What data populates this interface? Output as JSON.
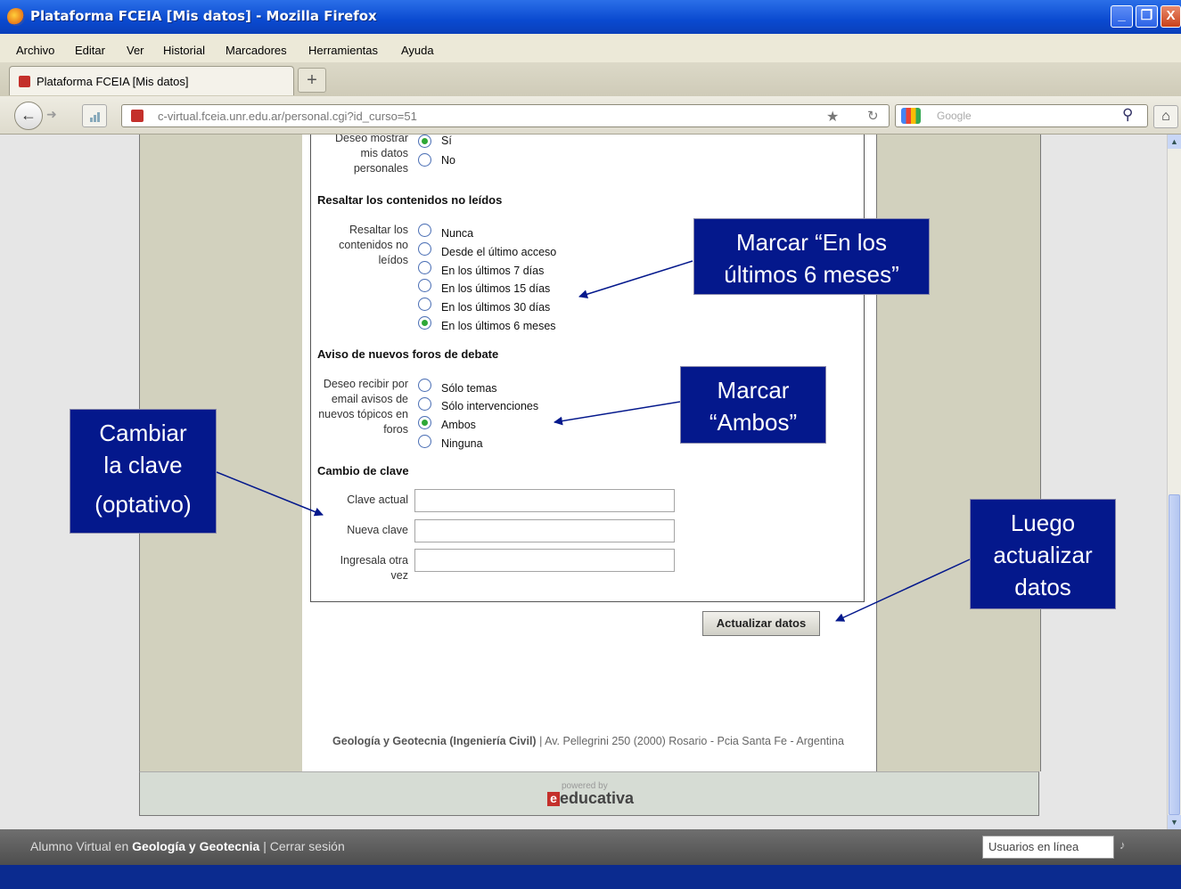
{
  "window": {
    "title": "Plataforma FCEIA [Mis datos] - Mozilla Firefox",
    "min_label": "_",
    "max_label": "❐",
    "close_label": "X"
  },
  "menu": [
    "Archivo",
    "Editar",
    "Ver",
    "Historial",
    "Marcadores",
    "Herramientas",
    "Ayuda"
  ],
  "tab": {
    "label": "Plataforma FCEIA [Mis datos]",
    "new_tab_label": "+"
  },
  "nav": {
    "url": "c-virtual.fceia.unr.edu.ar/personal.cgi?id_curso=51",
    "search_placeholder": "Google"
  },
  "form": {
    "personal": {
      "label": "Deseo mostrar mis datos personales",
      "options": [
        "Sí",
        "No"
      ],
      "selected": "Sí"
    },
    "resaltar": {
      "title": "Resaltar los contenidos no leídos",
      "label": "Resaltar los contenidos no leídos",
      "options": [
        "Nunca",
        "Desde el último acceso",
        "En los últimos 7 días",
        "En los últimos 15 días",
        "En los últimos 30 días",
        "En los últimos 6 meses"
      ],
      "selected": "En los últimos 6 meses"
    },
    "aviso": {
      "title": "Aviso de nuevos foros de debate",
      "label": "Deseo recibir por email avisos de nuevos tópicos en foros",
      "options": [
        "Sólo temas",
        "Sólo intervenciones",
        "Ambos",
        "Ninguna"
      ],
      "selected": "Ambos"
    },
    "clave": {
      "title": "Cambio de clave",
      "actual_label": "Clave actual",
      "nueva_label": "Nueva clave",
      "repetir_label": "Ingresala otra vez",
      "actual_value": "",
      "nueva_value": "",
      "repetir_value": ""
    },
    "submit_label": "Actualizar datos"
  },
  "credits": {
    "name": "Geología y Geotecnia (Ingeniería Civil)",
    "separator": "|",
    "address": "Av. Pellegrini 250 (2000) Rosario - Pcia Santa Fe - Argentina"
  },
  "logo": {
    "powered": "powered by",
    "brand": "educativa",
    "mark": "e"
  },
  "statusbar": {
    "prefix": "Alumno Virtual en",
    "course": "Geología y Geotecnia",
    "separator": "|",
    "logout": "Cerrar sesión",
    "online": "Usuarios en línea"
  },
  "callouts": {
    "resaltar": [
      "Marcar “En los",
      "últimos 6 meses”"
    ],
    "ambos": [
      "Marcar",
      "“Ambos”"
    ],
    "clave": [
      "Cambiar",
      "la clave",
      "(optativo)"
    ],
    "actualizar": [
      "Luego",
      "actualizar",
      "datos"
    ]
  },
  "colors": {
    "callout_bg": "#04188c",
    "titlebar": "#0a4ad0",
    "radio_selected": "#2ea836"
  }
}
